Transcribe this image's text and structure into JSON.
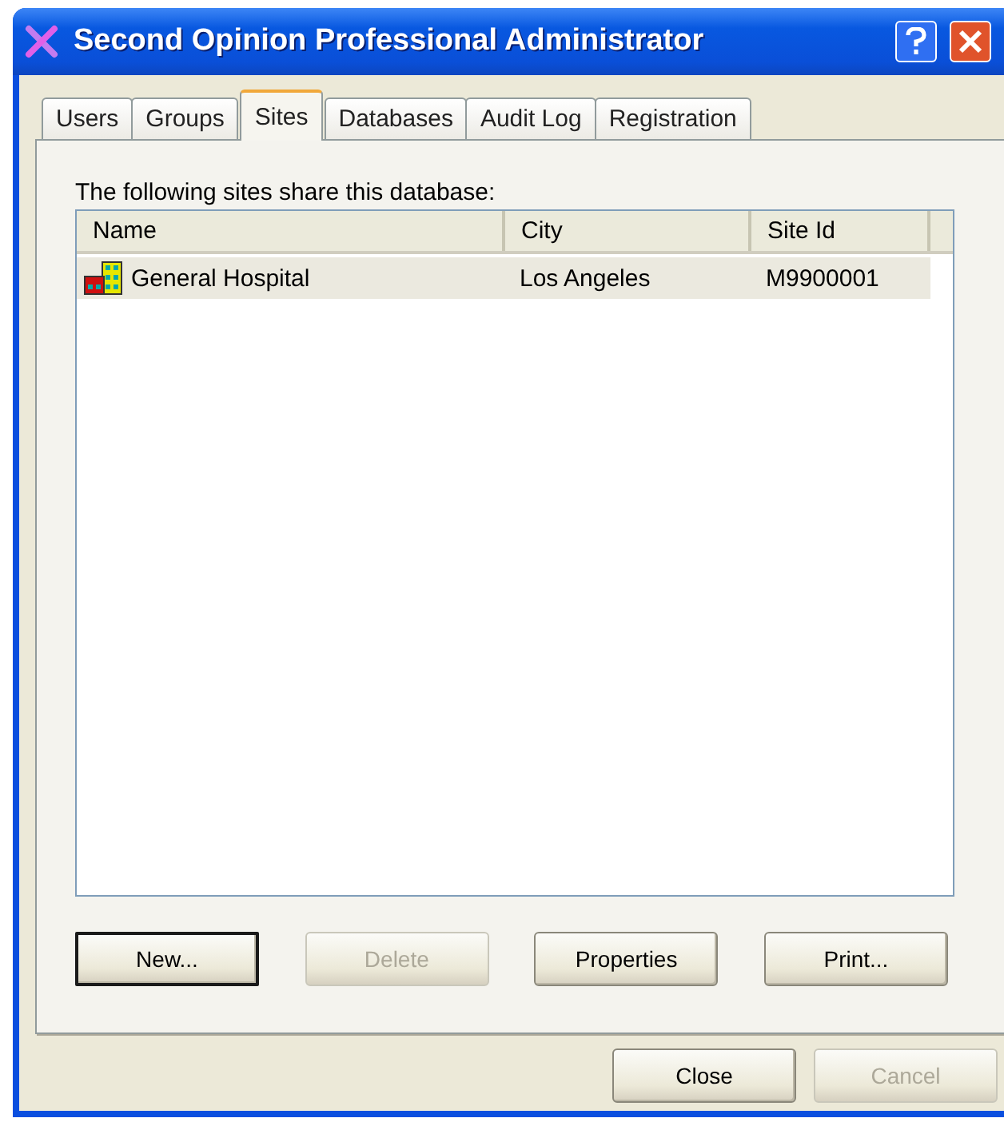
{
  "window": {
    "title": "Second Opinion Professional Administrator"
  },
  "tabs": [
    {
      "label": "Users",
      "selected": false
    },
    {
      "label": "Groups",
      "selected": false
    },
    {
      "label": "Sites",
      "selected": true
    },
    {
      "label": "Databases",
      "selected": false
    },
    {
      "label": "Audit Log",
      "selected": false
    },
    {
      "label": "Registration",
      "selected": false
    }
  ],
  "list_label": "The following sites share this database:",
  "table": {
    "columns": [
      "Name",
      "City",
      "Site Id"
    ],
    "rows": [
      {
        "cells": [
          "General Hospital",
          "Los Angeles",
          "M9900001"
        ],
        "selected": true
      }
    ]
  },
  "buttons": [
    {
      "label": "New...",
      "disabled": false,
      "default": true
    },
    {
      "label": "Delete",
      "disabled": true,
      "default": false
    },
    {
      "label": "Properties",
      "disabled": false,
      "default": false
    },
    {
      "label": "Print...",
      "disabled": false,
      "default": false
    }
  ],
  "dialog_buttons": [
    {
      "label": "Close",
      "disabled": false
    },
    {
      "label": "Cancel",
      "disabled": true
    }
  ]
}
